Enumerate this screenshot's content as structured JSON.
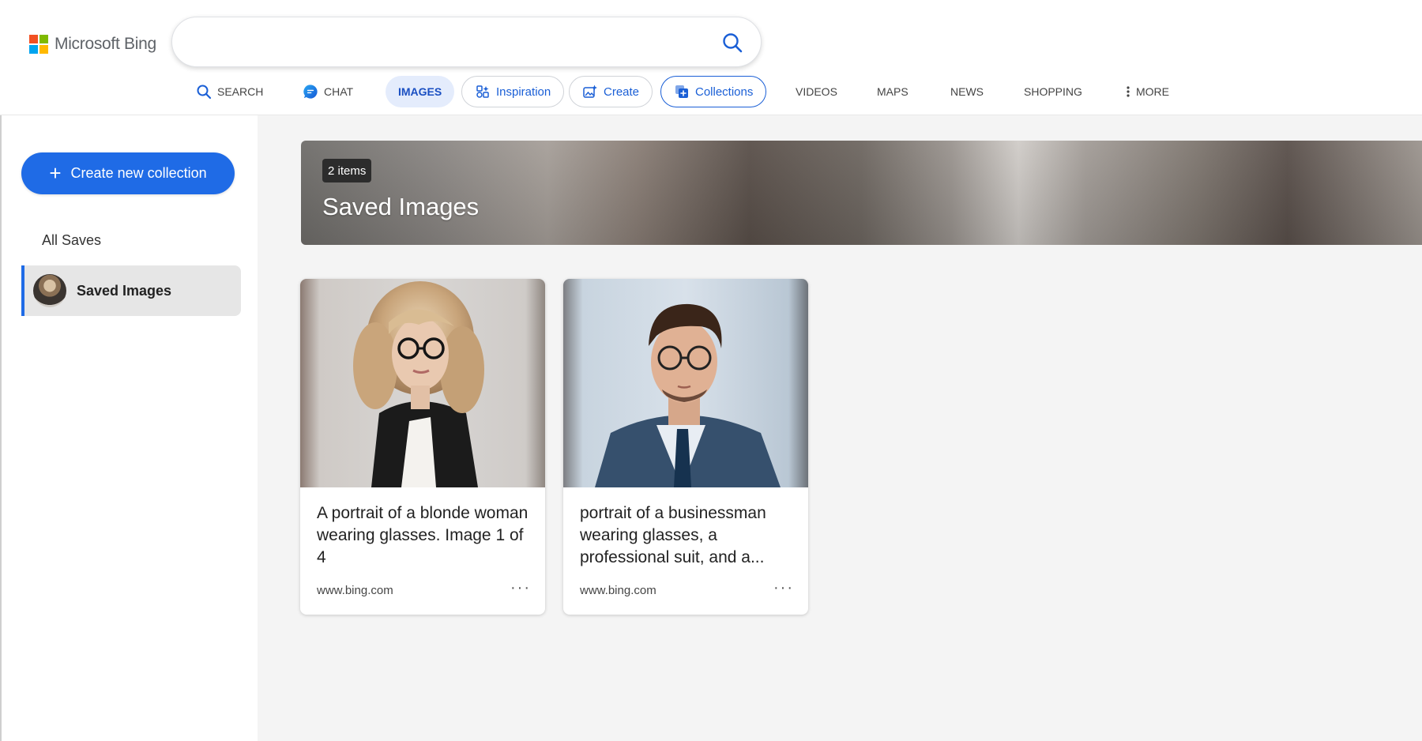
{
  "header": {
    "logo_text": "Microsoft Bing",
    "search": {
      "value": "",
      "placeholder": ""
    }
  },
  "nav": {
    "items": [
      {
        "label": "SEARCH",
        "icon": "search-icon"
      },
      {
        "label": "CHAT",
        "icon": "chat-icon"
      },
      {
        "label": "IMAGES",
        "active": true
      },
      {
        "label": "Inspiration",
        "icon": "inspiration-icon"
      },
      {
        "label": "Create",
        "icon": "create-icon"
      },
      {
        "label": "Collections",
        "icon": "collections-icon",
        "selected": true
      },
      {
        "label": "VIDEOS"
      },
      {
        "label": "MAPS"
      },
      {
        "label": "NEWS"
      },
      {
        "label": "SHOPPING"
      },
      {
        "label": "MORE",
        "icon": "more-vertical-icon"
      }
    ]
  },
  "sidebar": {
    "create_label": "Create new collection",
    "all_saves_label": "All Saves",
    "collections": [
      {
        "label": "Saved Images",
        "selected": true
      }
    ]
  },
  "main": {
    "banner": {
      "count_label": "2 items",
      "title": "Saved Images"
    },
    "cards": [
      {
        "caption": "A portrait of a blonde woman wearing glasses. Image 1 of 4",
        "source": "www.bing.com",
        "more_label": "···"
      },
      {
        "caption": "portrait of a businessman wearing glasses, a professional suit, and a...",
        "source": "www.bing.com",
        "more_label": "···"
      }
    ]
  },
  "colors": {
    "accent": "#1f6be6",
    "nav_active_bg": "#e4ecfc",
    "main_bg": "#f4f4f4"
  }
}
